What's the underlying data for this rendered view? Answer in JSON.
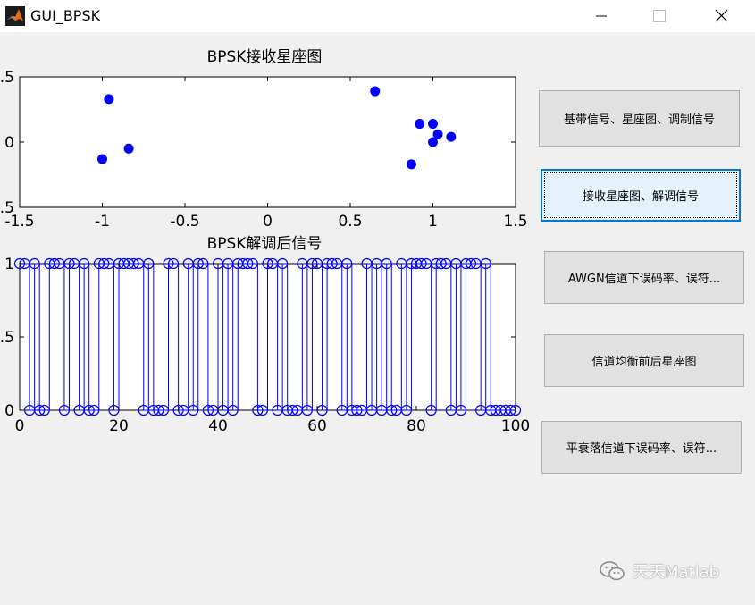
{
  "window": {
    "title": "GUI_BPSK",
    "minimize_icon": "minimize-icon",
    "maximize_icon": "maximize-icon",
    "close_icon": "close-icon"
  },
  "buttons": [
    {
      "label": "基带信号、星座图、调制信号"
    },
    {
      "label": "接收星座图、解调信号"
    },
    {
      "label": "AWGN信道下误码率、误符..."
    },
    {
      "label": "信道均衡前后星座图"
    },
    {
      "label": "平衰落信道下误码率、误符..."
    }
  ],
  "watermark": {
    "text": "天天Matlab",
    "icon": "wechat-icon"
  },
  "colors": {
    "marker": "#0000ff",
    "background": "#f0f0f0",
    "axes_bg": "#ffffff"
  },
  "chart_data": [
    {
      "type": "scatter",
      "title": "BPSK接收星座图",
      "xlim": [
        -1.5,
        1.5
      ],
      "ylim": [
        -0.5,
        0.5
      ],
      "xticks": [
        "-1.5",
        "-1",
        "-0.5",
        "0",
        "0.5",
        "1",
        "1.5"
      ],
      "yticks": [
        ".5",
        "0",
        ".5"
      ],
      "grid": false,
      "points": [
        {
          "x": -1.0,
          "y": -0.13
        },
        {
          "x": -0.96,
          "y": 0.33
        },
        {
          "x": -0.84,
          "y": -0.05
        },
        {
          "x": 0.65,
          "y": 0.39
        },
        {
          "x": 0.87,
          "y": -0.17
        },
        {
          "x": 0.92,
          "y": 0.14
        },
        {
          "x": 1.0,
          "y": 0.14
        },
        {
          "x": 1.0,
          "y": 0.0
        },
        {
          "x": 1.03,
          "y": 0.06
        },
        {
          "x": 1.11,
          "y": 0.04
        }
      ]
    },
    {
      "type": "line",
      "style": "stem-stairs",
      "title": "BPSK解调后信号",
      "xlim": [
        0,
        100
      ],
      "ylim": [
        0,
        1
      ],
      "xticks": [
        "0",
        "20",
        "40",
        "60",
        "80",
        "100"
      ],
      "yticks": [
        "1",
        ".5",
        "0"
      ],
      "grid": false,
      "values": [
        1,
        1,
        0,
        1,
        0,
        0,
        1,
        1,
        1,
        0,
        1,
        1,
        0,
        1,
        0,
        0,
        1,
        1,
        1,
        0,
        1,
        1,
        1,
        1,
        1,
        0,
        1,
        0,
        0,
        0,
        1,
        1,
        0,
        0,
        1,
        0,
        1,
        1,
        0,
        0,
        1,
        0,
        1,
        0,
        1,
        1,
        1,
        1,
        0,
        0,
        1,
        1,
        0,
        1,
        0,
        0,
        0,
        1,
        0,
        1,
        1,
        0,
        1,
        1,
        1,
        0,
        1,
        0,
        0,
        0,
        1,
        0,
        1,
        0,
        1,
        0,
        0,
        1,
        0,
        1,
        1,
        1,
        1,
        0,
        1,
        1,
        1,
        0,
        1,
        0,
        1,
        1,
        1,
        0,
        1,
        0,
        0,
        0,
        0,
        0,
        0
      ]
    }
  ]
}
